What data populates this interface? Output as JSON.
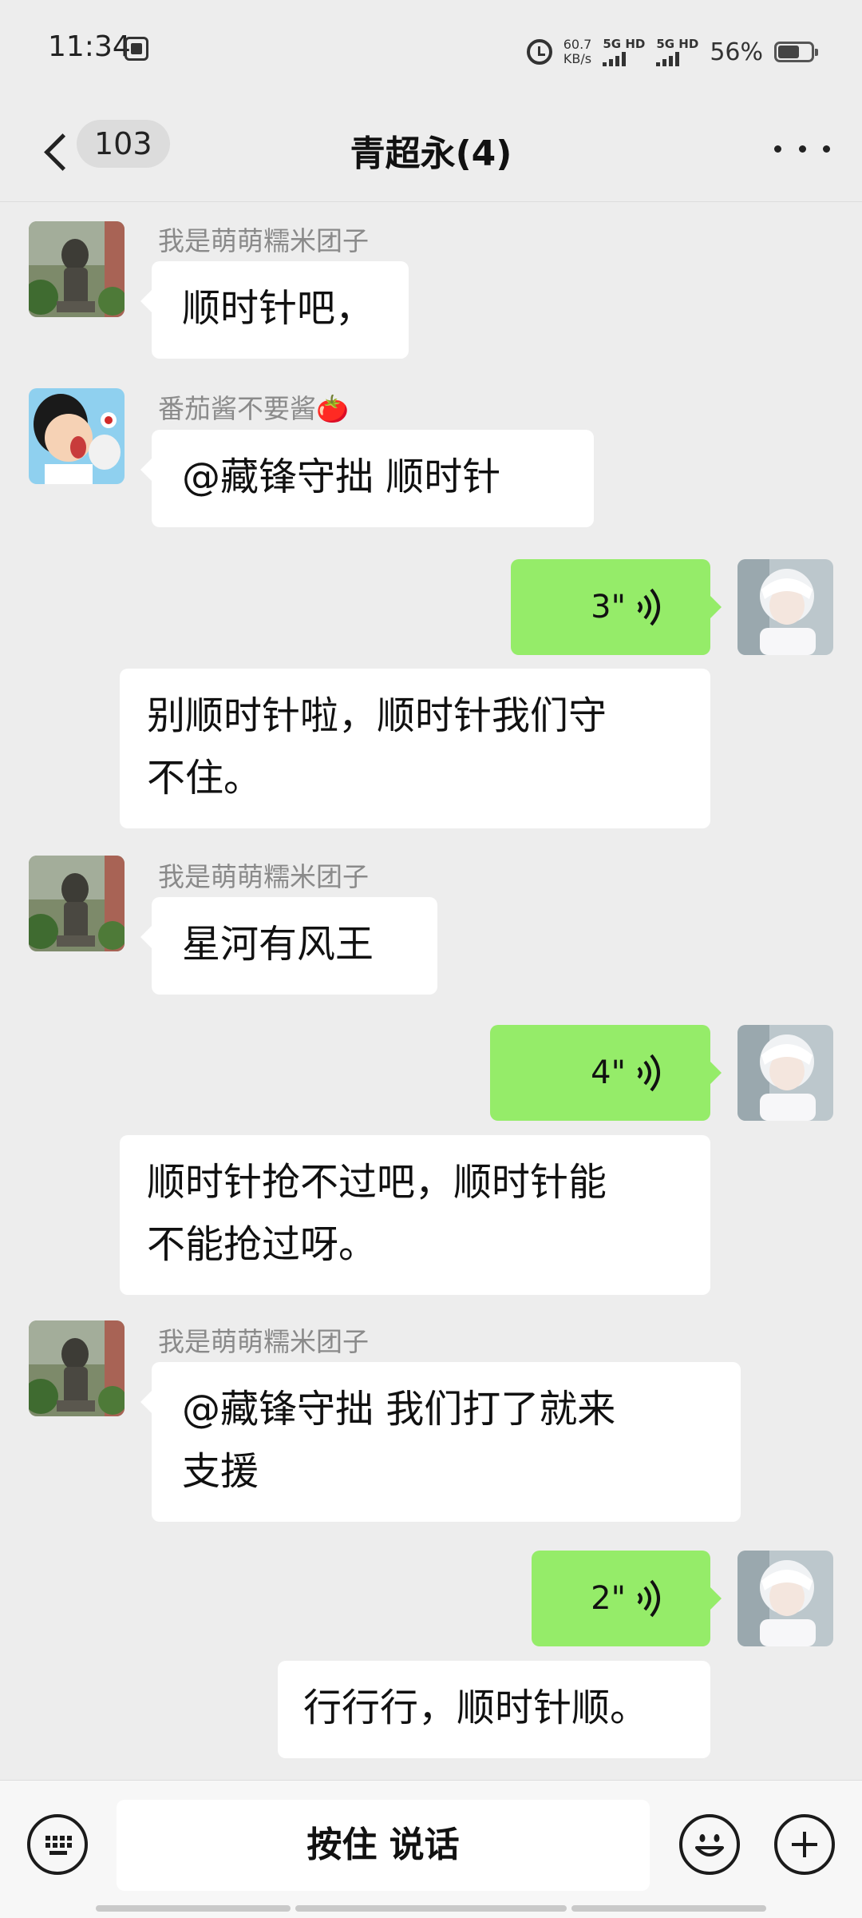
{
  "status": {
    "time": "11:34",
    "net_speed_value": "60.7",
    "net_speed_unit": "KB/s",
    "sim1": "5G HD",
    "sim2": "5G HD",
    "battery": "56%"
  },
  "header": {
    "unread_count": "103",
    "title": "青超永(4)"
  },
  "messages": [
    {
      "sender": "我是萌萌糯米团子",
      "text": "顺时针吧，"
    },
    {
      "sender": "番茄酱不要酱🍅",
      "text": "@藏锋守拙  顺时针"
    },
    {
      "self_voice_duration": "3\"",
      "text_line1": "别顺时针啦，顺时针我们守",
      "text_line2": "不住。"
    },
    {
      "sender": "我是萌萌糯米团子",
      "text": "星河有风王"
    },
    {
      "self_voice_duration": "4\"",
      "text_line1": "顺时针抢不过吧，顺时针能",
      "text_line2": "不能抢过呀。"
    },
    {
      "sender": "我是萌萌糯米团子",
      "text_line1": "@藏锋守拙  我们打了就来",
      "text_line2": "支援"
    },
    {
      "self_voice_duration": "2\"",
      "text": "行行行，顺时针顺。"
    }
  ],
  "input_bar": {
    "hold_to_talk": "按住 说话"
  },
  "colors": {
    "background": "#ededed",
    "voice_bubble": "#95ec69",
    "bubble": "#ffffff"
  }
}
